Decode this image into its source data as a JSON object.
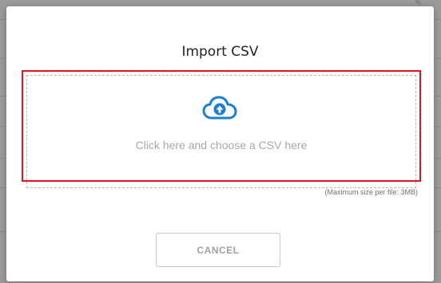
{
  "modal": {
    "title": "Import CSV",
    "dropzone_text": "Click here and choose a CSV here",
    "size_note": "(Maximum size per file: 3MB)",
    "cancel_label": "CANCEL",
    "upload_icon": "cloud-upload-icon",
    "accent_color": "#1a7fd4",
    "highlight_color": "#e0141e"
  },
  "background": {
    "edit_icon": "edit-icon"
  }
}
